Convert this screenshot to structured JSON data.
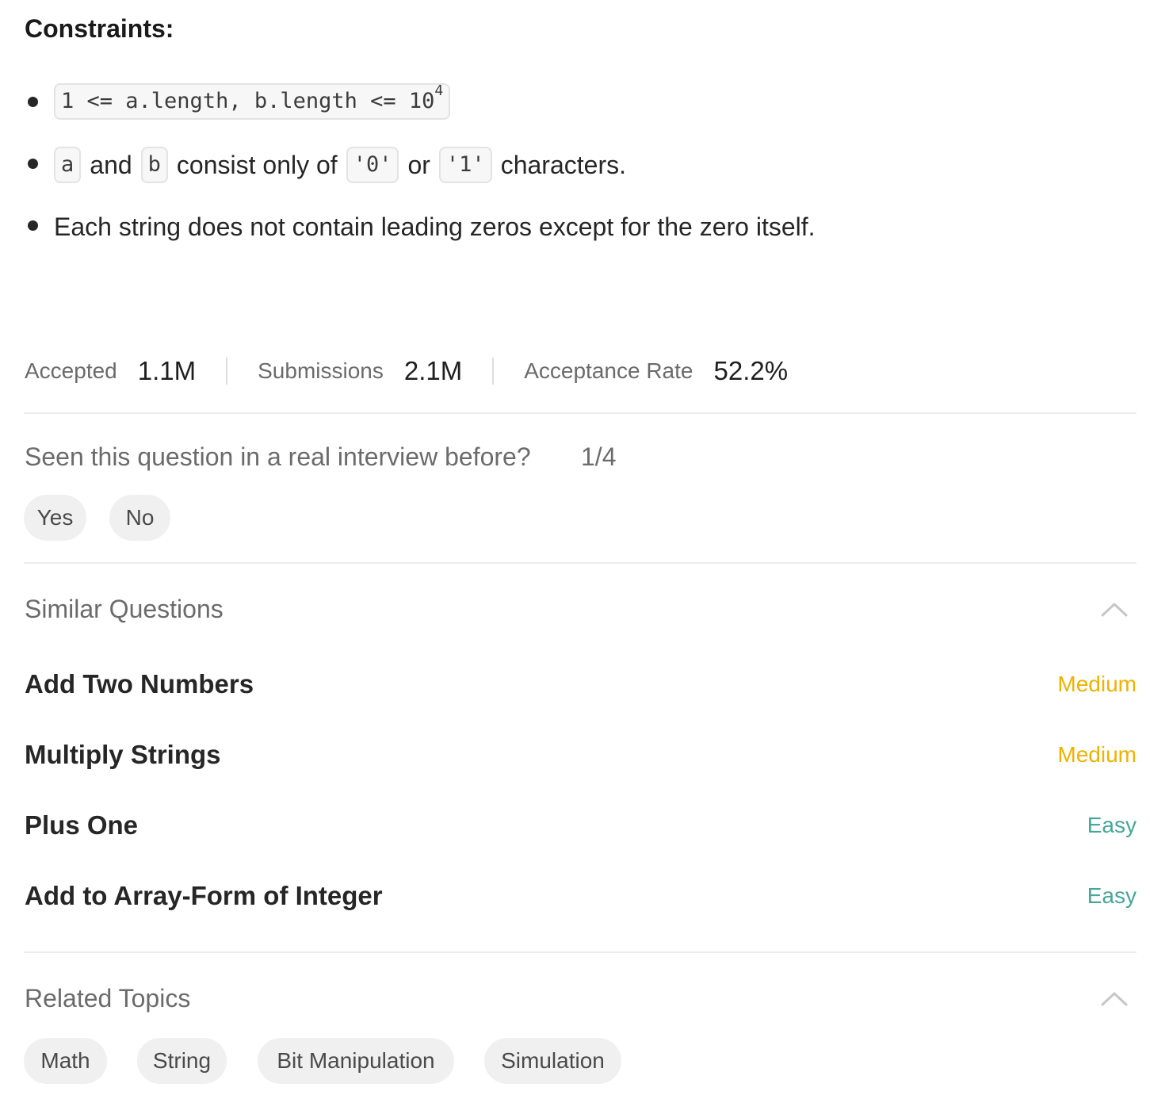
{
  "constraints": {
    "heading": "Constraints:",
    "item1": {
      "code_text": "1 <= a.length, b.length <= 10",
      "code_sup": "4"
    },
    "item2": {
      "code_a": "a",
      "text_and": "and",
      "code_b": "b",
      "text_consist": "consist only of",
      "code_zero": "'0'",
      "text_or": "or",
      "code_one": "'1'",
      "text_characters": "characters."
    },
    "item3": {
      "text": "Each string does not contain leading zeros except for the zero itself."
    }
  },
  "stats": {
    "accepted_label": "Accepted",
    "accepted_value": "1.1M",
    "submissions_label": "Submissions",
    "submissions_value": "2.1M",
    "rate_label": "Acceptance Rate",
    "rate_value": "52.2%"
  },
  "interview": {
    "question": "Seen this question in a real interview before?",
    "count": "1/4",
    "yes_label": "Yes",
    "no_label": "No"
  },
  "similar": {
    "title": "Similar Questions",
    "items": [
      {
        "title": "Add Two Numbers",
        "difficulty": "Medium"
      },
      {
        "title": "Multiply Strings",
        "difficulty": "Medium"
      },
      {
        "title": "Plus One",
        "difficulty": "Easy"
      },
      {
        "title": "Add to Array-Form of Integer",
        "difficulty": "Easy"
      }
    ]
  },
  "topics": {
    "title": "Related Topics",
    "items": [
      "Math",
      "String",
      "Bit Manipulation",
      "Simulation"
    ]
  },
  "colors": {
    "medium": "#f0b100",
    "easy": "#46a69a",
    "chevron": "#c6c6c6"
  },
  "icons": {
    "similar_toggle": "chevron-up-icon",
    "topics_toggle": "chevron-up-icon"
  }
}
